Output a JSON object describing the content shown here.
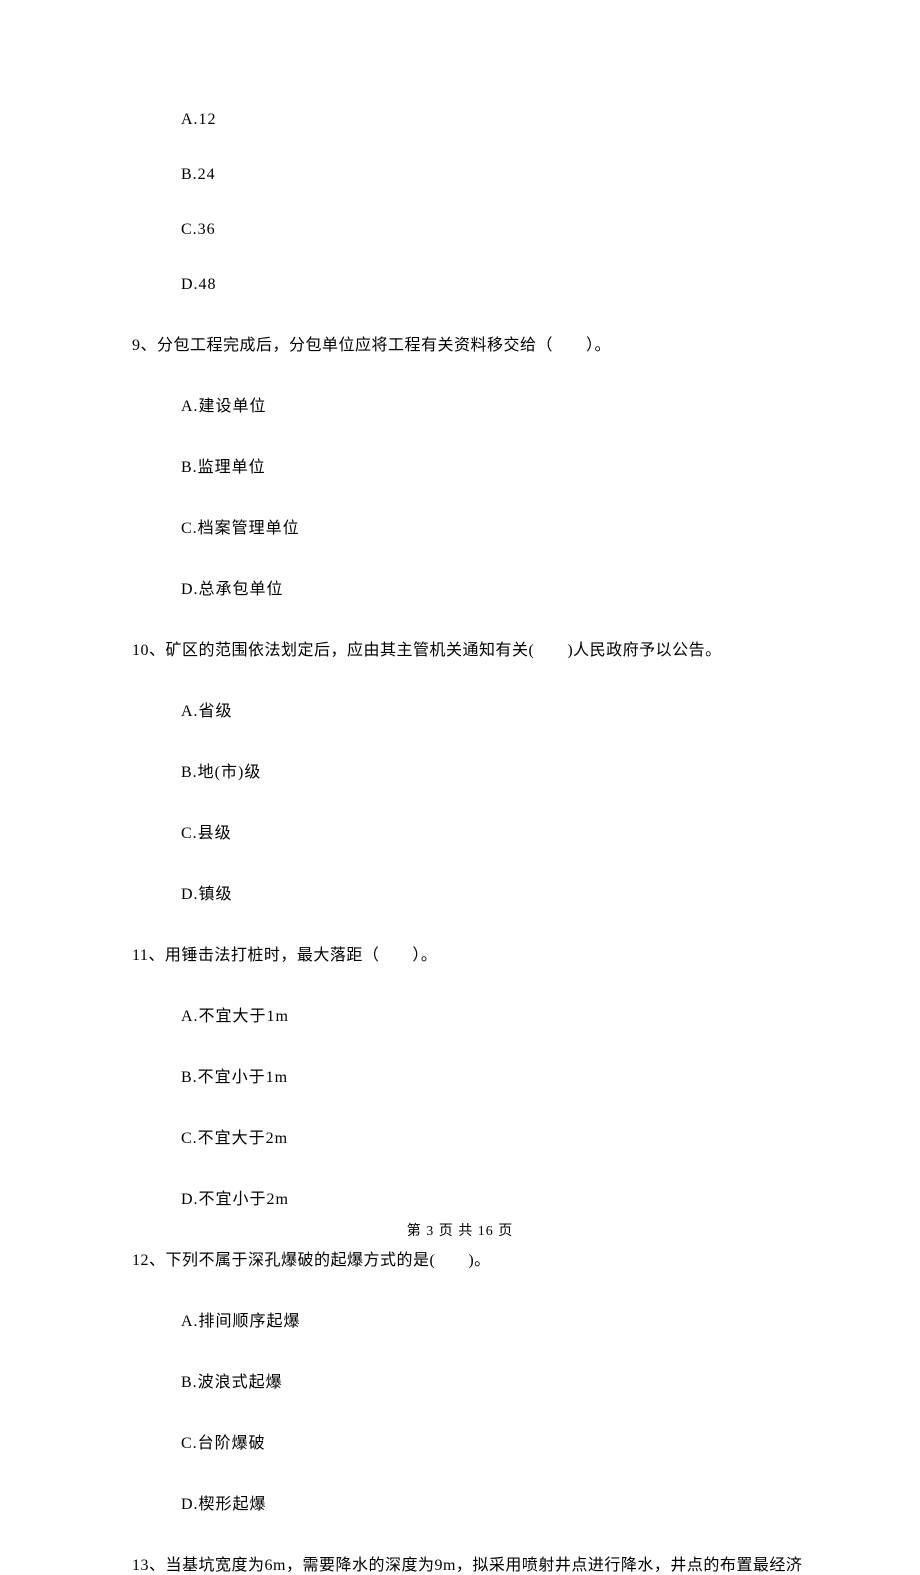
{
  "prev_options": {
    "a": "A.12",
    "b": "B.24",
    "c": "C.36",
    "d": "D.48"
  },
  "q9": {
    "text": "9、分包工程完成后，分包单位应将工程有关资料移交给（　　）。",
    "a": "A.建设单位",
    "b": "B.监理单位",
    "c": "C.档案管理单位",
    "d": "D.总承包单位"
  },
  "q10": {
    "text": "10、矿区的范围依法划定后，应由其主管机关通知有关(　　)人民政府予以公告。",
    "a": "A.省级",
    "b": "B.地(市)级",
    "c": "C.县级",
    "d": "D.镇级"
  },
  "q11": {
    "text": "11、用锤击法打桩时，最大落距（　　）。",
    "a": "A.不宜大于1m",
    "b": "B.不宜小于1m",
    "c": "C.不宜大于2m",
    "d": "D.不宜小于2m"
  },
  "q12": {
    "text": "12、下列不属于深孔爆破的起爆方式的是(　　)。",
    "a": "A.排间顺序起爆",
    "b": "B.波浪式起爆",
    "c": "C.台阶爆破",
    "d": "D.楔形起爆"
  },
  "q13": {
    "text": "13、当基坑宽度为6m，需要降水的深度为9m，拟采用喷射井点进行降水，井点的布置最经济"
  },
  "footer": "第 3 页 共 16 页"
}
